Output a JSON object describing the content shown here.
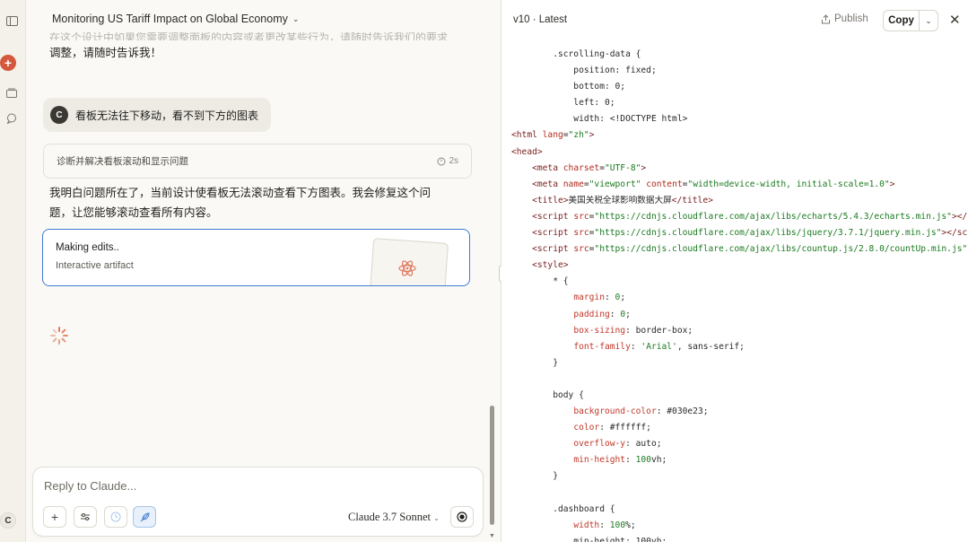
{
  "sidebar": {
    "icons": [
      "sidebar-toggle-icon",
      "new-chat-icon",
      "projects-icon",
      "chats-icon"
    ],
    "avatar": "C",
    "new_chat": "+"
  },
  "chat": {
    "title": "Monitoring US Tariff Impact on Global Economy",
    "faded_line": "在这个设计中如果您需要调整面板的内容或者更改某些行为，请随时告诉我们的要求",
    "prev_text": "调整，请随时告诉我！",
    "user_message": "看板无法往下移动，看不到下方的图表",
    "user_avatar": "C",
    "thinking": {
      "label": "诊断并解决看板滚动和显示问题",
      "time": "2s"
    },
    "reply_line1": "我明白问题所在了，当前设计使看板无法滚动查看下方图表。我会修复这个问",
    "reply_line2": "题，让您能够滚动查看所有内容。",
    "artifact": {
      "status": "Making edits..",
      "kind": "Interactive artifact"
    }
  },
  "input": {
    "placeholder": "Reply to Claude...",
    "model": "Claude 3.7 Sonnet",
    "buttons": [
      "plus-icon",
      "sliders-icon",
      "clock-icon",
      "feather-icon"
    ]
  },
  "panel": {
    "version": "v10 · Latest",
    "publish": "Publish",
    "copy": "Copy"
  },
  "code_lines": [
    [
      {
        "t": "        .scrolling-data {",
        "c": ""
      }
    ],
    [
      {
        "t": "            position: fixed;",
        "c": ""
      }
    ],
    [
      {
        "t": "            bottom: 0;",
        "c": ""
      }
    ],
    [
      {
        "t": "            left: 0;",
        "c": ""
      }
    ],
    [
      {
        "t": "            width: <!DOCTYPE html>",
        "c": ""
      }
    ],
    [
      {
        "t": "<html ",
        "c": "tag"
      },
      {
        "t": "lang",
        "c": "att"
      },
      {
        "t": "=",
        "c": ""
      },
      {
        "t": "\"zh\"",
        "c": "str"
      },
      {
        "t": ">",
        "c": "tag"
      }
    ],
    [
      {
        "t": "<head>",
        "c": "tag"
      }
    ],
    [
      {
        "t": "    <meta ",
        "c": "tag"
      },
      {
        "t": "charset",
        "c": "att"
      },
      {
        "t": "=",
        "c": ""
      },
      {
        "t": "\"UTF-8\"",
        "c": "str"
      },
      {
        "t": ">",
        "c": "tag"
      }
    ],
    [
      {
        "t": "    <meta ",
        "c": "tag"
      },
      {
        "t": "name",
        "c": "att"
      },
      {
        "t": "=",
        "c": ""
      },
      {
        "t": "\"viewport\"",
        "c": "str"
      },
      {
        "t": " content",
        "c": "att"
      },
      {
        "t": "=",
        "c": ""
      },
      {
        "t": "\"width=device-width, initial-scale=1.0\"",
        "c": "str"
      },
      {
        "t": ">",
        "c": "tag"
      }
    ],
    [
      {
        "t": "    <title>",
        "c": "tag"
      },
      {
        "t": "美国关税全球影响数据大屏",
        "c": ""
      },
      {
        "t": "</title>",
        "c": "tag"
      }
    ],
    [
      {
        "t": "    <script ",
        "c": "tag"
      },
      {
        "t": "src",
        "c": "att"
      },
      {
        "t": "=",
        "c": ""
      },
      {
        "t": "\"https://cdnjs.cloudflare.com/ajax/libs/echarts/5.4.3/echarts.min.js\"",
        "c": "str"
      },
      {
        "t": "></",
        "c": "tag"
      }
    ],
    [
      {
        "t": "    <script ",
        "c": "tag"
      },
      {
        "t": "src",
        "c": "att"
      },
      {
        "t": "=",
        "c": ""
      },
      {
        "t": "\"https://cdnjs.cloudflare.com/ajax/libs/jquery/3.7.1/jquery.min.js\"",
        "c": "str"
      },
      {
        "t": "></sc",
        "c": "tag"
      }
    ],
    [
      {
        "t": "    <script ",
        "c": "tag"
      },
      {
        "t": "src",
        "c": "att"
      },
      {
        "t": "=",
        "c": ""
      },
      {
        "t": "\"https://cdnjs.cloudflare.com/ajax/libs/countup.js/2.8.0/countUp.min.js\"",
        "c": "str"
      }
    ],
    [
      {
        "t": "    <style>",
        "c": "tag"
      }
    ],
    [
      {
        "t": "        * {",
        "c": ""
      }
    ],
    [
      {
        "t": "            ",
        "c": ""
      },
      {
        "t": "margin",
        "c": "prop"
      },
      {
        "t": ": ",
        "c": ""
      },
      {
        "t": "0",
        "c": "num"
      },
      {
        "t": ";",
        "c": ""
      }
    ],
    [
      {
        "t": "            ",
        "c": ""
      },
      {
        "t": "padding",
        "c": "prop"
      },
      {
        "t": ": ",
        "c": ""
      },
      {
        "t": "0",
        "c": "num"
      },
      {
        "t": ";",
        "c": ""
      }
    ],
    [
      {
        "t": "            ",
        "c": ""
      },
      {
        "t": "box-sizing",
        "c": "prop"
      },
      {
        "t": ": border-box;",
        "c": ""
      }
    ],
    [
      {
        "t": "            ",
        "c": ""
      },
      {
        "t": "font-family",
        "c": "prop"
      },
      {
        "t": ": ",
        "c": ""
      },
      {
        "t": "'Arial'",
        "c": "str"
      },
      {
        "t": ", sans-serif;",
        "c": ""
      }
    ],
    [
      {
        "t": "        }",
        "c": ""
      }
    ],
    [
      {
        "t": "",
        "c": ""
      }
    ],
    [
      {
        "t": "        body {",
        "c": ""
      }
    ],
    [
      {
        "t": "            ",
        "c": ""
      },
      {
        "t": "background-color",
        "c": "prop"
      },
      {
        "t": ": #030e23;",
        "c": ""
      }
    ],
    [
      {
        "t": "            ",
        "c": ""
      },
      {
        "t": "color",
        "c": "prop"
      },
      {
        "t": ": #ffffff;",
        "c": ""
      }
    ],
    [
      {
        "t": "            ",
        "c": ""
      },
      {
        "t": "overflow-y",
        "c": "prop"
      },
      {
        "t": ": auto;",
        "c": ""
      }
    ],
    [
      {
        "t": "            ",
        "c": ""
      },
      {
        "t": "min-height",
        "c": "prop"
      },
      {
        "t": ": ",
        "c": ""
      },
      {
        "t": "100",
        "c": "num"
      },
      {
        "t": "vh;",
        "c": ""
      }
    ],
    [
      {
        "t": "        }",
        "c": ""
      }
    ],
    [
      {
        "t": "",
        "c": ""
      }
    ],
    [
      {
        "t": "        .dashboard {",
        "c": ""
      }
    ],
    [
      {
        "t": "            ",
        "c": ""
      },
      {
        "t": "width",
        "c": "prop"
      },
      {
        "t": ": ",
        "c": ""
      },
      {
        "t": "100",
        "c": "num"
      },
      {
        "t": "%;",
        "c": ""
      }
    ],
    [
      {
        "t": "            min-height: 100vh;",
        "c": ""
      }
    ]
  ]
}
